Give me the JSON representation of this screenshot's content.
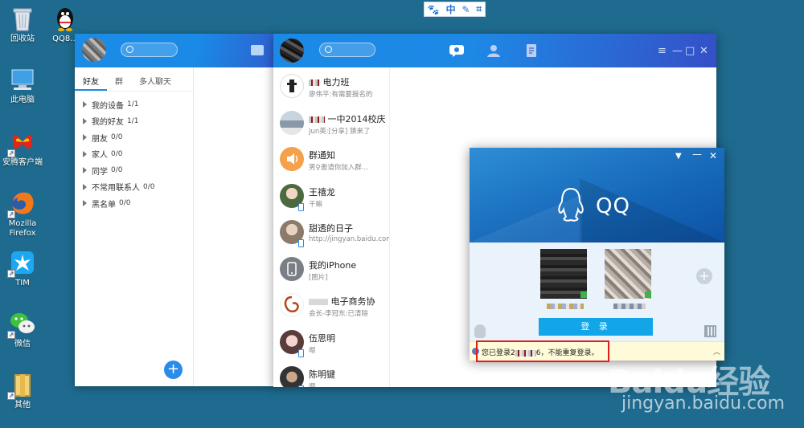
{
  "desktop": {
    "icons": [
      {
        "label": "回收站"
      },
      {
        "label": "QQ8..."
      },
      {
        "label": "此电脑"
      },
      {
        "label": "安腾客户端"
      },
      {
        "label": "Mozilla Firefox"
      },
      {
        "label": "TIM"
      },
      {
        "label": "微信"
      },
      {
        "label": "其他"
      }
    ]
  },
  "ime": {
    "icons": [
      "paw-icon",
      "chinese-mode",
      "pencil-icon",
      "crop-icon"
    ],
    "mode_label": "中"
  },
  "contacts_window": {
    "tabs": [
      {
        "label": "好友"
      },
      {
        "label": "群"
      },
      {
        "label": "多人聊天"
      }
    ],
    "groups": [
      {
        "label": "我的设备",
        "count": "1/1"
      },
      {
        "label": "我的好友",
        "count": "1/1"
      },
      {
        "label": "朋友",
        "count": "0/0"
      },
      {
        "label": "家人",
        "count": "0/0"
      },
      {
        "label": "同学",
        "count": "0/0"
      },
      {
        "label": "不常用联系人",
        "count": "0/0"
      },
      {
        "label": "黑名单",
        "count": "0/0"
      }
    ],
    "add_button_label": "+"
  },
  "chat_window": {
    "nav": [
      "message-icon",
      "contacts-icon",
      "notes-icon"
    ],
    "controls": [
      "≡",
      "—",
      "□",
      "✕"
    ],
    "chats": [
      {
        "name": "电力班",
        "msg": "廖伟平:有需要报名的",
        "avatar_color": "#ffffff",
        "mobile": false
      },
      {
        "name": "一中2014校庆",
        "msg": "Jun英:[分享] 猜来了",
        "avatar_color": "#9aa7b5",
        "mobile": false
      },
      {
        "name": "群通知",
        "msg": "男♀邀请你加入群...",
        "avatar_color": "#f5a04a",
        "mobile": false
      },
      {
        "name": "王禧龙",
        "msg": "干嘛",
        "avatar_color": "#6f8f6a",
        "mobile": true
      },
      {
        "name": "甜透的日子",
        "msg": "http://jingyan.baidu.com/",
        "avatar_color": "#b8a08a",
        "mobile": true
      },
      {
        "name": "我的iPhone",
        "msg": "[图片]",
        "avatar_color": "#7a7f86",
        "mobile": false
      },
      {
        "name": "电子商务协",
        "msg": "会长-李冠东:已清除",
        "avatar_color": "#c9a38a",
        "mobile": false
      },
      {
        "name": "伍思明",
        "msg": "嗯",
        "avatar_color": "#d49aa6",
        "mobile": true
      },
      {
        "name": "陈明键",
        "msg": "嗯",
        "avatar_color": "#555555",
        "mobile": true
      }
    ]
  },
  "login_window": {
    "title": "QQ",
    "login_button": "登 录",
    "warning": "您已登录2",
    "warning_tail": "6，不能重复登录。"
  },
  "watermark": {
    "logo": "Baidu经验",
    "url": "jingyan.baidu.com"
  }
}
